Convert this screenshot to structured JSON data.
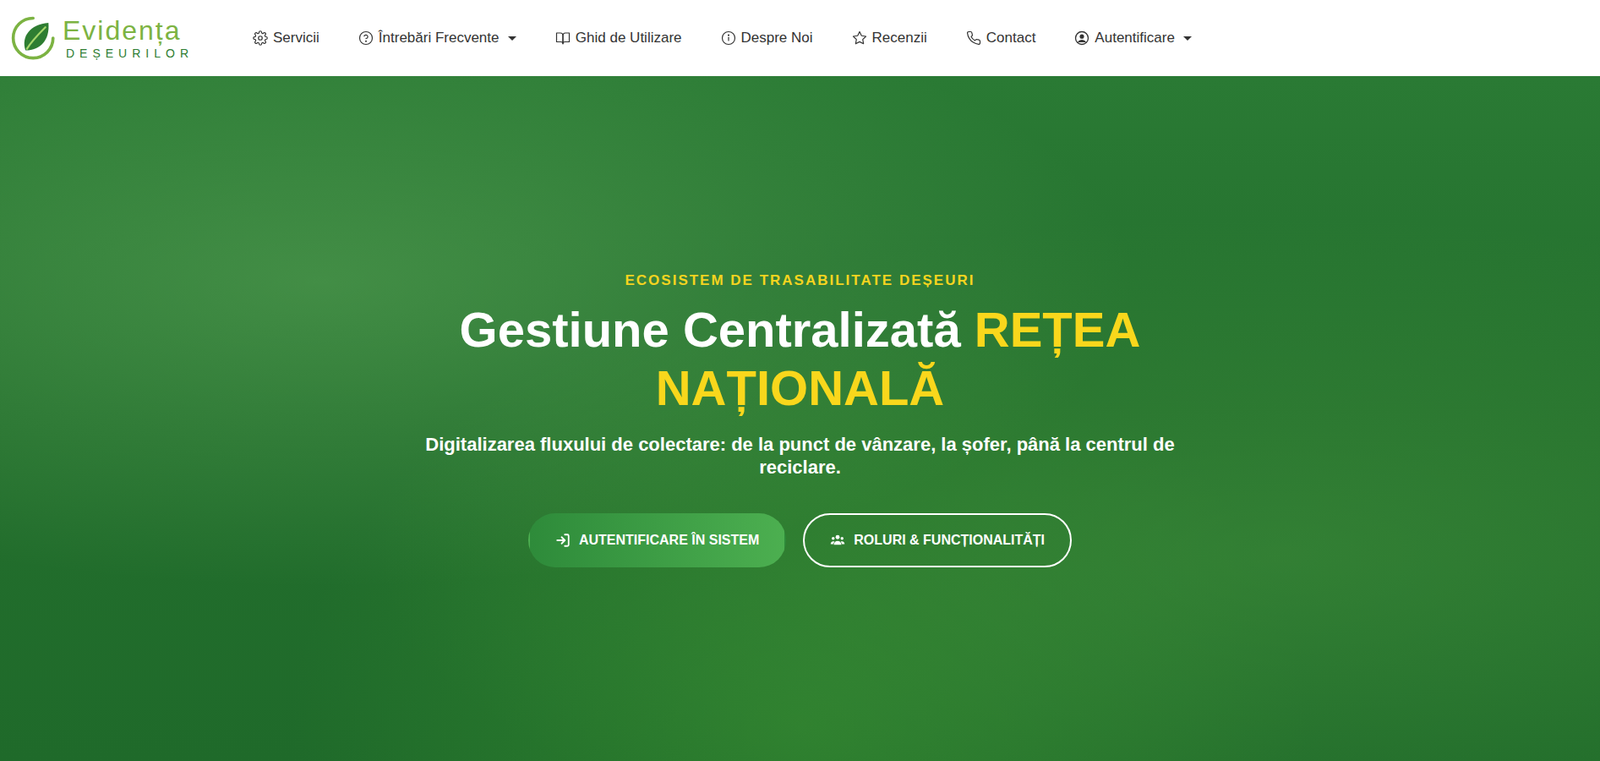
{
  "logo": {
    "title": "Evidența",
    "subtitle": "DEȘEURILOR"
  },
  "nav": [
    {
      "label": "Servicii",
      "dropdown": false
    },
    {
      "label": "Întrebări Frecvente",
      "dropdown": true
    },
    {
      "label": "Ghid de Utilizare",
      "dropdown": false
    },
    {
      "label": "Despre Noi",
      "dropdown": false
    },
    {
      "label": "Recenzii",
      "dropdown": false
    },
    {
      "label": "Contact",
      "dropdown": false
    },
    {
      "label": "Autentificare",
      "dropdown": true
    }
  ],
  "hero": {
    "eyebrow": "ECOSISTEM DE TRASABILITATE DEȘEURI",
    "title": "Gestiune Centralizată",
    "title_highlight": "REȚEA NAȚIONALĂ",
    "subtitle": "Digitalizarea fluxului de colectare: de la punct de vânzare, la șofer, până la centrul de reciclare.",
    "buttons": [
      {
        "label": "AUTENTIFICARE ÎN SISTEM",
        "kind": "primary"
      },
      {
        "label": "ROLURI & FUNCȚIONALITĂȚI",
        "kind": "outline"
      }
    ]
  }
}
